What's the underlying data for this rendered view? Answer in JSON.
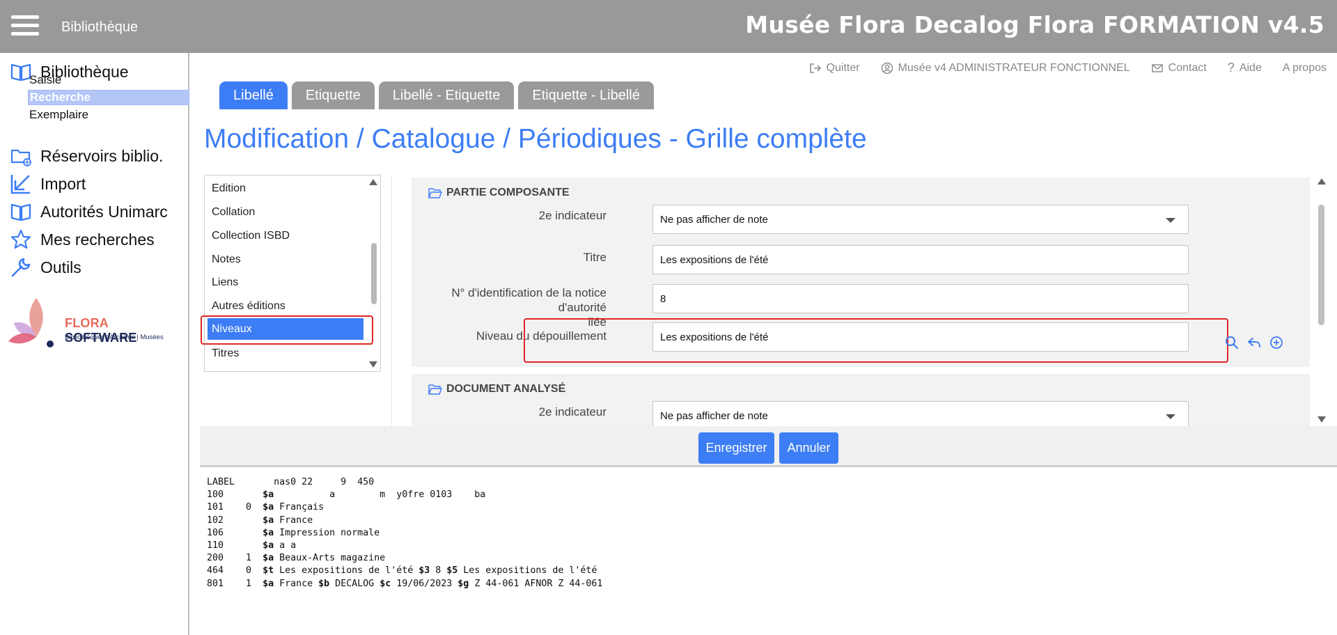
{
  "topbar": {
    "module": "Bibliothèque",
    "title": "Musée Flora Decalog Flora FORMATION v4.5"
  },
  "sidebar": {
    "bibliotheque": "Bibliothèque",
    "saisie": "Saisie",
    "recherche": "Recherche",
    "exemplaire": "Exemplaire",
    "reservoirs": "Réservoirs biblio.",
    "import": "Import",
    "autorites": "Autorités Unimarc",
    "mes_recherches": "Mes recherches",
    "outils": "Outils"
  },
  "logo": {
    "name_part1": "FLORA",
    "name_part2": "SOFTWARE",
    "tagline": "Bibliothèques | Archives | Musées"
  },
  "toplinks": {
    "quitter": "Quitter",
    "user": "Musée v4 ADMINISTRATEUR FONCTIONNEL",
    "contact": "Contact",
    "aide": "Aide",
    "apropos": "A propos"
  },
  "tabs": [
    "Libellé",
    "Etiquette",
    "Libellé - Etiquette",
    "Etiquette - Libellé"
  ],
  "page_title": "Modification / Catalogue / Périodiques - Grille complète",
  "field_list": [
    "Edition",
    "Collation",
    "Collection ISBD",
    "Notes",
    "Liens",
    "Autres éditions",
    "Niveaux",
    "Titres"
  ],
  "section1": {
    "title": "PARTIE COMPOSANTE",
    "indicator_label": "2e indicateur",
    "indicator_value": "Ne pas afficher de note",
    "titre_label": "Titre",
    "titre_value": "Les expositions de l'été",
    "id_label_line1": "N° d'identification de la notice d'autorité",
    "id_label_line2": "liée",
    "id_value": "8",
    "niveau_label": "Niveau du dépouillement",
    "niveau_value": "Les expositions de l'été"
  },
  "section2": {
    "title": "DOCUMENT ANALYSÉ",
    "indicator_label": "2e indicateur",
    "indicator_value": "Ne pas afficher de note"
  },
  "buttons": {
    "save": "Enregistrer",
    "cancel": "Annuler"
  },
  "unimarc": [
    {
      "tag": "LABEL",
      "ind": "",
      "text": "       nas0 22     9  450"
    },
    {
      "tag": "100",
      "ind": "",
      "parts": [
        [
          "$a",
          "         a        m  y0fre 0103    ba"
        ]
      ]
    },
    {
      "tag": "101",
      "ind": "0",
      "parts": [
        [
          "$a",
          "Français"
        ]
      ]
    },
    {
      "tag": "102",
      "ind": "",
      "parts": [
        [
          "$a",
          "France"
        ]
      ]
    },
    {
      "tag": "106",
      "ind": "",
      "parts": [
        [
          "$a",
          "Impression normale"
        ]
      ]
    },
    {
      "tag": "110",
      "ind": "",
      "parts": [
        [
          "$a",
          "a a"
        ]
      ]
    },
    {
      "tag": "200",
      "ind": "1",
      "parts": [
        [
          "$a",
          "Beaux-Arts magazine"
        ]
      ]
    },
    {
      "tag": "464",
      "ind": "0",
      "parts": [
        [
          "$t",
          "Les expositions de l'été"
        ],
        [
          "$3",
          "8"
        ],
        [
          "$5",
          "Les expositions de l'été"
        ]
      ]
    },
    {
      "tag": "801",
      "ind": "1",
      "parts": [
        [
          "$a",
          "France"
        ],
        [
          "$b",
          "DECALOG"
        ],
        [
          "$c",
          "19/06/2023"
        ],
        [
          "$g",
          "Z 44-061 AFNOR Z 44-061"
        ]
      ]
    }
  ]
}
